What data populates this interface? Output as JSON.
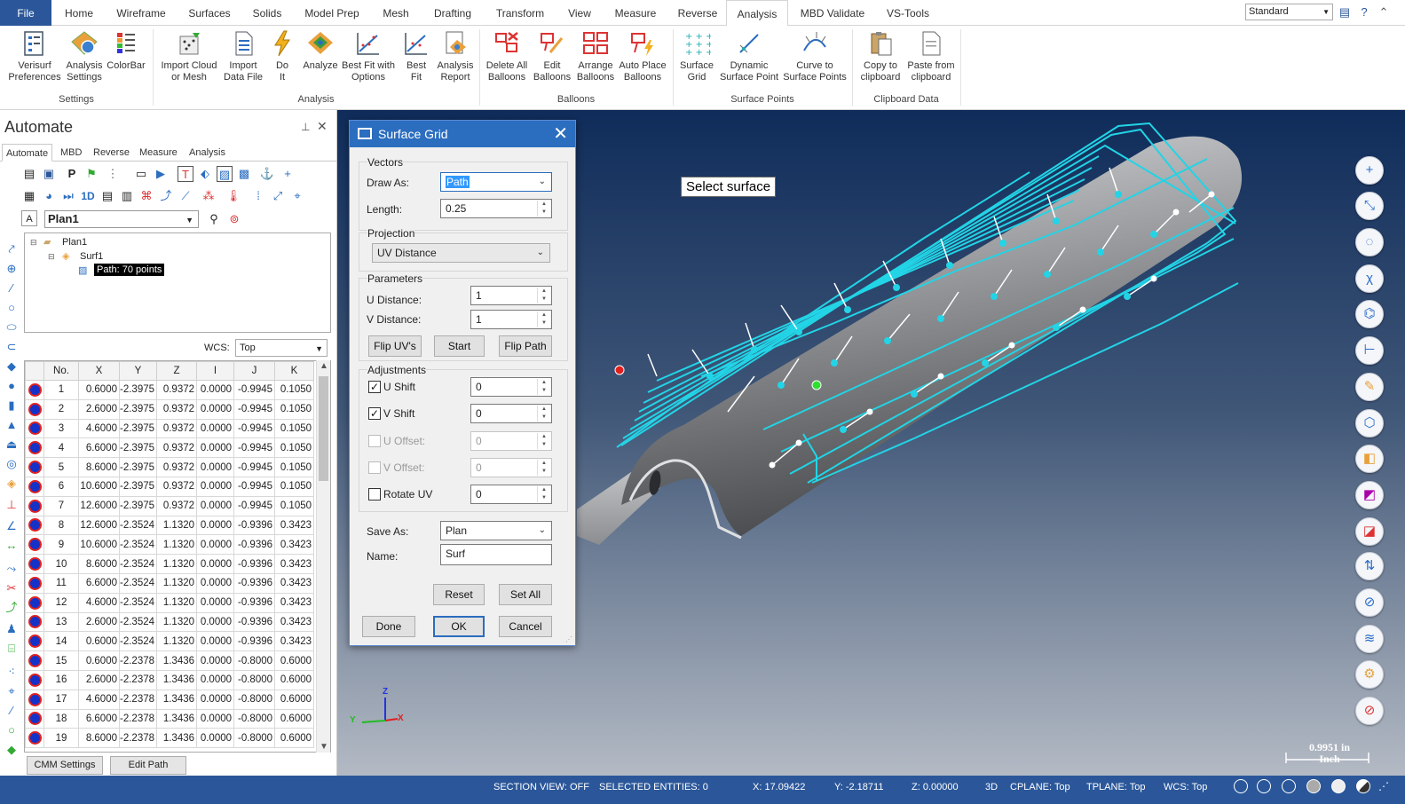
{
  "ribbon_tabs": [
    "File",
    "Home",
    "Wireframe",
    "Surfaces",
    "Solids",
    "Model Prep",
    "Mesh",
    "Drafting",
    "Transform",
    "View",
    "Measure",
    "Reverse",
    "Analysis",
    "MBD Validate",
    "VS-Tools"
  ],
  "standard_select": "Standard",
  "ribbon": {
    "settings": {
      "label": "Settings",
      "buttons": [
        {
          "l1": "Verisurf",
          "l2": "Preferences"
        },
        {
          "l1": "Analysis",
          "l2": "Settings"
        },
        {
          "l1": "ColorBar",
          "l2": ""
        }
      ]
    },
    "analysis": {
      "label": "Analysis",
      "buttons": [
        {
          "l1": "Import Cloud",
          "l2": "or Mesh"
        },
        {
          "l1": "Import",
          "l2": "Data File"
        },
        {
          "l1": "Do",
          "l2": "It"
        },
        {
          "l1": "Analyze",
          "l2": ""
        },
        {
          "l1": "Best Fit with",
          "l2": "Options"
        },
        {
          "l1": "Best",
          "l2": "Fit"
        },
        {
          "l1": "Analysis",
          "l2": "Report"
        }
      ]
    },
    "balloons": {
      "label": "Balloons",
      "buttons": [
        {
          "l1": "Delete All",
          "l2": "Balloons"
        },
        {
          "l1": "Edit",
          "l2": "Balloons"
        },
        {
          "l1": "Arrange",
          "l2": "Balloons"
        },
        {
          "l1": "Auto Place",
          "l2": "Balloons"
        }
      ]
    },
    "surface_points": {
      "label": "Surface Points",
      "buttons": [
        {
          "l1": "Surface",
          "l2": "Grid"
        },
        {
          "l1": "Dynamic",
          "l2": "Surface Point"
        },
        {
          "l1": "Curve to",
          "l2": "Surface Points"
        }
      ]
    },
    "clipboard": {
      "label": "Clipboard Data",
      "buttons": [
        {
          "l1": "Copy to",
          "l2": "clipboard"
        },
        {
          "l1": "Paste from",
          "l2": "clipboard"
        }
      ]
    }
  },
  "panel": {
    "title": "Automate",
    "tabs": [
      "Automate",
      "MBD",
      "Reverse",
      "Measure",
      "Analysis"
    ],
    "plan_select": "Plan1",
    "tree": {
      "root": "Plan1",
      "child": "Surf1",
      "leaf": "Path: 70 points"
    },
    "wcs_label": "WCS:",
    "wcs_value": "Top",
    "columns": [
      "No.",
      "X",
      "Y",
      "Z",
      "I",
      "J",
      "K"
    ],
    "rows": [
      [
        "1",
        "0.6000",
        "-2.3975",
        "0.9372",
        "0.0000",
        "-0.9945",
        "0.1050"
      ],
      [
        "2",
        "2.6000",
        "-2.3975",
        "0.9372",
        "0.0000",
        "-0.9945",
        "0.1050"
      ],
      [
        "3",
        "4.6000",
        "-2.3975",
        "0.9372",
        "0.0000",
        "-0.9945",
        "0.1050"
      ],
      [
        "4",
        "6.6000",
        "-2.3975",
        "0.9372",
        "0.0000",
        "-0.9945",
        "0.1050"
      ],
      [
        "5",
        "8.6000",
        "-2.3975",
        "0.9372",
        "0.0000",
        "-0.9945",
        "0.1050"
      ],
      [
        "6",
        "10.6000",
        "-2.3975",
        "0.9372",
        "0.0000",
        "-0.9945",
        "0.1050"
      ],
      [
        "7",
        "12.6000",
        "-2.3975",
        "0.9372",
        "0.0000",
        "-0.9945",
        "0.1050"
      ],
      [
        "8",
        "12.6000",
        "-2.3524",
        "1.1320",
        "0.0000",
        "-0.9396",
        "0.3423"
      ],
      [
        "9",
        "10.6000",
        "-2.3524",
        "1.1320",
        "0.0000",
        "-0.9396",
        "0.3423"
      ],
      [
        "10",
        "8.6000",
        "-2.3524",
        "1.1320",
        "0.0000",
        "-0.9396",
        "0.3423"
      ],
      [
        "11",
        "6.6000",
        "-2.3524",
        "1.1320",
        "0.0000",
        "-0.9396",
        "0.3423"
      ],
      [
        "12",
        "4.6000",
        "-2.3524",
        "1.1320",
        "0.0000",
        "-0.9396",
        "0.3423"
      ],
      [
        "13",
        "2.6000",
        "-2.3524",
        "1.1320",
        "0.0000",
        "-0.9396",
        "0.3423"
      ],
      [
        "14",
        "0.6000",
        "-2.3524",
        "1.1320",
        "0.0000",
        "-0.9396",
        "0.3423"
      ],
      [
        "15",
        "0.6000",
        "-2.2378",
        "1.3436",
        "0.0000",
        "-0.8000",
        "0.6000"
      ],
      [
        "16",
        "2.6000",
        "-2.2378",
        "1.3436",
        "0.0000",
        "-0.8000",
        "0.6000"
      ],
      [
        "17",
        "4.6000",
        "-2.2378",
        "1.3436",
        "0.0000",
        "-0.8000",
        "0.6000"
      ],
      [
        "18",
        "6.6000",
        "-2.2378",
        "1.3436",
        "0.0000",
        "-0.8000",
        "0.6000"
      ],
      [
        "19",
        "8.6000",
        "-2.2378",
        "1.3436",
        "0.0000",
        "-0.8000",
        "0.6000"
      ]
    ],
    "cmm_settings": "CMM Settings",
    "edit_path": "Edit Path"
  },
  "dialog": {
    "title": "Surface Grid",
    "vectors_label": "Vectors",
    "draw_as_label": "Draw As:",
    "draw_as_value": "Path",
    "length_label": "Length:",
    "length_value": "0.25",
    "projection_label": "Projection",
    "projection_value": "UV Distance",
    "parameters_label": "Parameters",
    "u_distance_label": "U Distance:",
    "u_distance_value": "1",
    "v_distance_label": "V Distance:",
    "v_distance_value": "1",
    "flip_uvs": "Flip UV's",
    "start": "Start",
    "flip_path": "Flip Path",
    "adjustments_label": "Adjustments",
    "u_shift_label": "U Shift",
    "u_shift_value": "0",
    "v_shift_label": "V Shift",
    "v_shift_value": "0",
    "u_offset_label": "U Offset:",
    "u_offset_value": "0",
    "v_offset_label": "V Offset:",
    "v_offset_value": "0",
    "rotate_uv_label": "Rotate UV",
    "rotate_uv_value": "0",
    "save_as_label": "Save As:",
    "save_as_value": "Plan",
    "name_label": "Name:",
    "name_value": "Surf",
    "reset": "Reset",
    "set_all": "Set All",
    "done": "Done",
    "ok": "OK",
    "cancel": "Cancel"
  },
  "viewport": {
    "prompt": "Select surface",
    "scale_value": "0.9951 in",
    "scale_unit": "Inch",
    "axis_x": "X",
    "axis_y": "Y",
    "axis_z": "Z"
  },
  "status": {
    "section_view": "SECTION VIEW: OFF",
    "selected": "SELECTED ENTITIES: 0",
    "x": "X:   17.09422",
    "y": "Y:   -2.18711",
    "z": "Z:   0.00000",
    "mode": "3D",
    "cplane": "CPLANE: Top",
    "tplane": "TPLANE: Top",
    "wcs": "WCS: Top"
  },
  "colors": {
    "accent": "#2b579a",
    "path": "#22d4e6",
    "dialog_title": "#2b6dbf"
  }
}
